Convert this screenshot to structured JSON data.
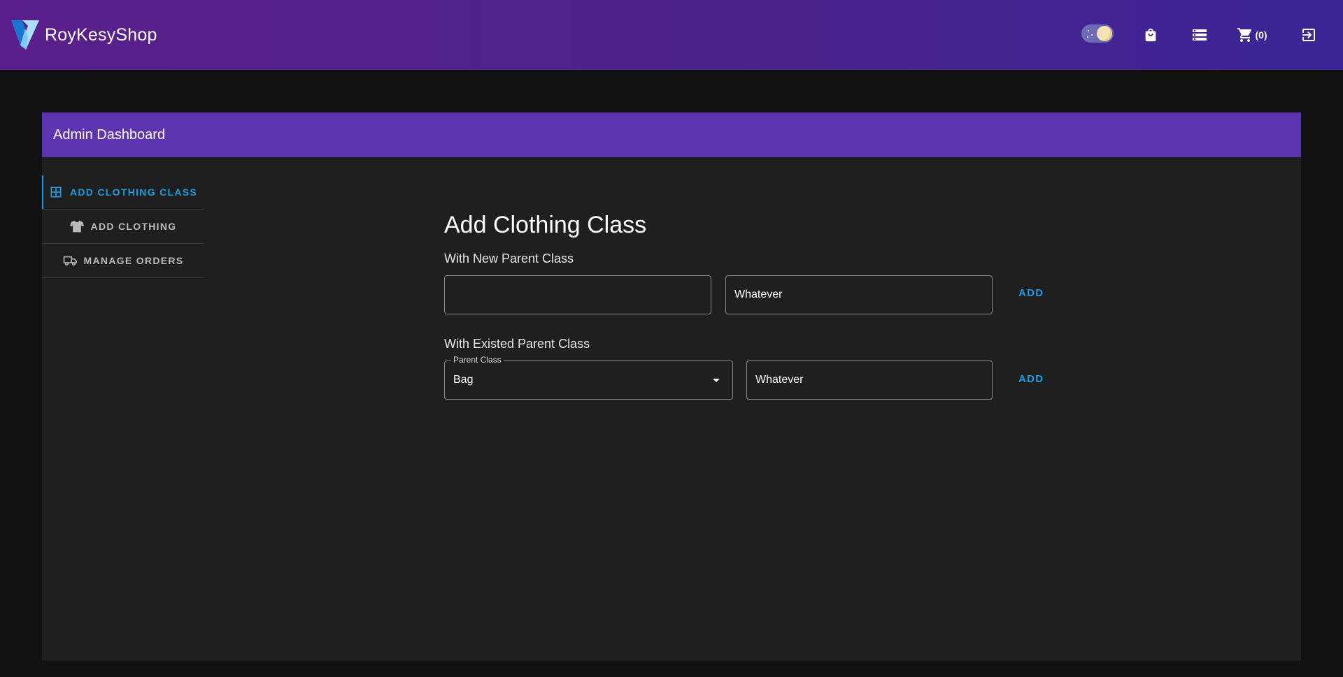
{
  "app": {
    "brand_name": "RoyKesyShop",
    "cart_count_label": "(0)"
  },
  "icons": {
    "logo": "vuetify-logo-icon",
    "theme_toggle": "dark-mode-toggle",
    "shop": "shopping-bag-icon",
    "dashboard": "server-icon",
    "cart": "cart-icon",
    "logout": "logout-icon"
  },
  "card": {
    "title": "Admin Dashboard"
  },
  "tabs": [
    {
      "label": "ADD CLOTHING CLASS",
      "icon": "table-icon",
      "active": true
    },
    {
      "label": "ADD CLOTHING",
      "icon": "tshirt-icon",
      "active": false
    },
    {
      "label": "MANAGE ORDERS",
      "icon": "truck-icon",
      "active": false
    }
  ],
  "form": {
    "title": "Add Clothing Class",
    "new_parent": {
      "label": "With New Parent Class",
      "parent_value": "",
      "class_value": "Whatever",
      "add_label": "ADD"
    },
    "existing_parent": {
      "label": "With Existed Parent Class",
      "select_label": "Parent Class",
      "select_value": "Bag",
      "class_value": "Whatever",
      "add_label": "ADD"
    }
  },
  "colors": {
    "accent": "#1e9be6",
    "header": "#5e35b1",
    "card_bg": "#1f1f1f",
    "page_bg": "#121212"
  }
}
